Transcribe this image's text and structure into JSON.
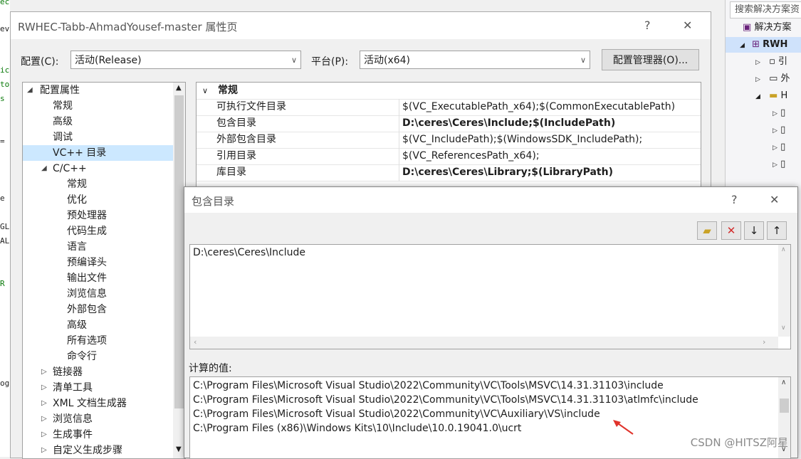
{
  "editor_fragments": [
    "ection.",
    "ev",
    "ic",
    "to",
    "s",
    "=",
    "e",
    "GL",
    "AL",
    "R",
    "og"
  ],
  "solution_explorer": {
    "search_placeholder": "搜索解决方案资",
    "root": "解决方案",
    "project": "RWH",
    "items": [
      "引",
      "外",
      "H"
    ]
  },
  "property_window": {
    "title": "RWHEC-Tabb-AhmadYousef-master 属性页",
    "help": "?",
    "close": "✕",
    "config_label": "配置(C):",
    "config_value": "活动(Release)",
    "platform_label": "平台(P):",
    "platform_value": "活动(x64)",
    "config_manager_button": "配置管理器(O)..."
  },
  "tree": {
    "root": "配置属性",
    "items": [
      {
        "label": "常规",
        "level": 1
      },
      {
        "label": "高级",
        "level": 1
      },
      {
        "label": "调试",
        "level": 1
      },
      {
        "label": "VC++ 目录",
        "level": 1,
        "selected": true
      },
      {
        "label": "C/C++",
        "level": 1,
        "expanded": true
      },
      {
        "label": "常规",
        "level": 2
      },
      {
        "label": "优化",
        "level": 2
      },
      {
        "label": "预处理器",
        "level": 2
      },
      {
        "label": "代码生成",
        "level": 2
      },
      {
        "label": "语言",
        "level": 2
      },
      {
        "label": "预编译头",
        "level": 2
      },
      {
        "label": "输出文件",
        "level": 2
      },
      {
        "label": "浏览信息",
        "level": 2
      },
      {
        "label": "外部包含",
        "level": 2
      },
      {
        "label": "高级",
        "level": 2
      },
      {
        "label": "所有选项",
        "level": 2
      },
      {
        "label": "命令行",
        "level": 2
      },
      {
        "label": "链接器",
        "level": 1,
        "collapsed": true
      },
      {
        "label": "清单工具",
        "level": 1,
        "collapsed": true
      },
      {
        "label": "XML 文档生成器",
        "level": 1,
        "collapsed": true
      },
      {
        "label": "浏览信息",
        "level": 1,
        "collapsed": true
      },
      {
        "label": "生成事件",
        "level": 1,
        "collapsed": true
      },
      {
        "label": "自定义生成步骤",
        "level": 1,
        "collapsed": true
      }
    ]
  },
  "grid": {
    "section": "常规",
    "rows": [
      {
        "name": "可执行文件目录",
        "value": "$(VC_ExecutablePath_x64);$(CommonExecutablePath)",
        "bold": false
      },
      {
        "name": "包含目录",
        "value": "D:\\ceres\\Ceres\\Include;$(IncludePath)",
        "bold": true
      },
      {
        "name": "外部包含目录",
        "value": "$(VC_IncludePath);$(WindowsSDK_IncludePath);",
        "bold": false
      },
      {
        "name": "引用目录",
        "value": "$(VC_ReferencesPath_x64);",
        "bold": false
      },
      {
        "name": "库目录",
        "value": "D:\\ceres\\Ceres\\Library;$(LibraryPath)",
        "bold": true
      }
    ]
  },
  "include_dialog": {
    "title": "包含目录",
    "help": "?",
    "close": "✕",
    "toolbar": {
      "new_line": "new-folder-icon",
      "delete": "delete-icon",
      "move_down": "arrow-down-icon",
      "move_up": "arrow-up-icon"
    },
    "edit_value": "D:\\ceres\\Ceres\\Include",
    "computed_label": "计算的值:",
    "computed_values": [
      "C:\\Program Files\\Microsoft Visual Studio\\2022\\Community\\VC\\Tools\\MSVC\\14.31.31103\\include",
      "C:\\Program Files\\Microsoft Visual Studio\\2022\\Community\\VC\\Tools\\MSVC\\14.31.31103\\atlmfc\\include",
      "C:\\Program Files\\Microsoft Visual Studio\\2022\\Community\\VC\\Auxiliary\\VS\\include",
      "C:\\Program Files (x86)\\Windows Kits\\10\\Include\\10.0.19041.0\\ucrt"
    ]
  },
  "watermark": "CSDN @HITSZ阿星",
  "colors": {
    "selection": "#cce8ff",
    "annotation_arrow": "#e0332b"
  }
}
